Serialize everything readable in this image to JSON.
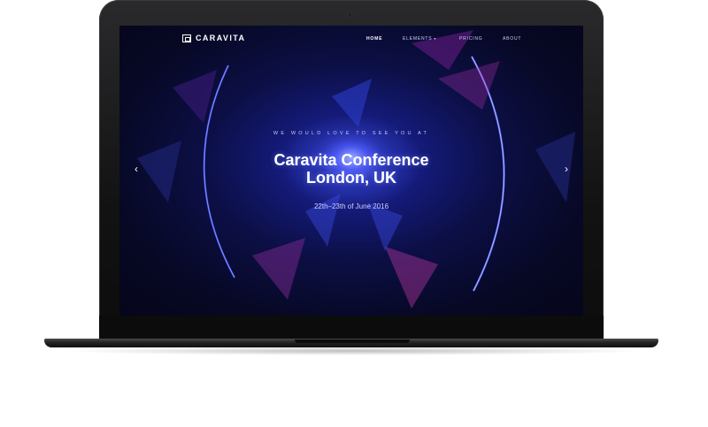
{
  "site": {
    "brand": "CARAVITA"
  },
  "nav": {
    "items": [
      {
        "label": "HOME",
        "active": true
      },
      {
        "label": "ELEMENTS",
        "dropdown": true
      },
      {
        "label": "PRICING"
      },
      {
        "label": "ABOUT"
      }
    ]
  },
  "hero": {
    "kicker": "WE WOULD LOVE TO SEE YOU AT",
    "title_line1": "Caravita Conference",
    "title_line2": "London, UK",
    "date": "22th–23th of June 2016"
  },
  "slider": {
    "prev_icon": "chevron-left-icon",
    "next_icon": "chevron-right-icon"
  },
  "colors": {
    "background_dark": "#070824",
    "glow_blue": "#6f7dff",
    "accent_magenta": "#c238b8",
    "text_white": "#ffffff"
  }
}
